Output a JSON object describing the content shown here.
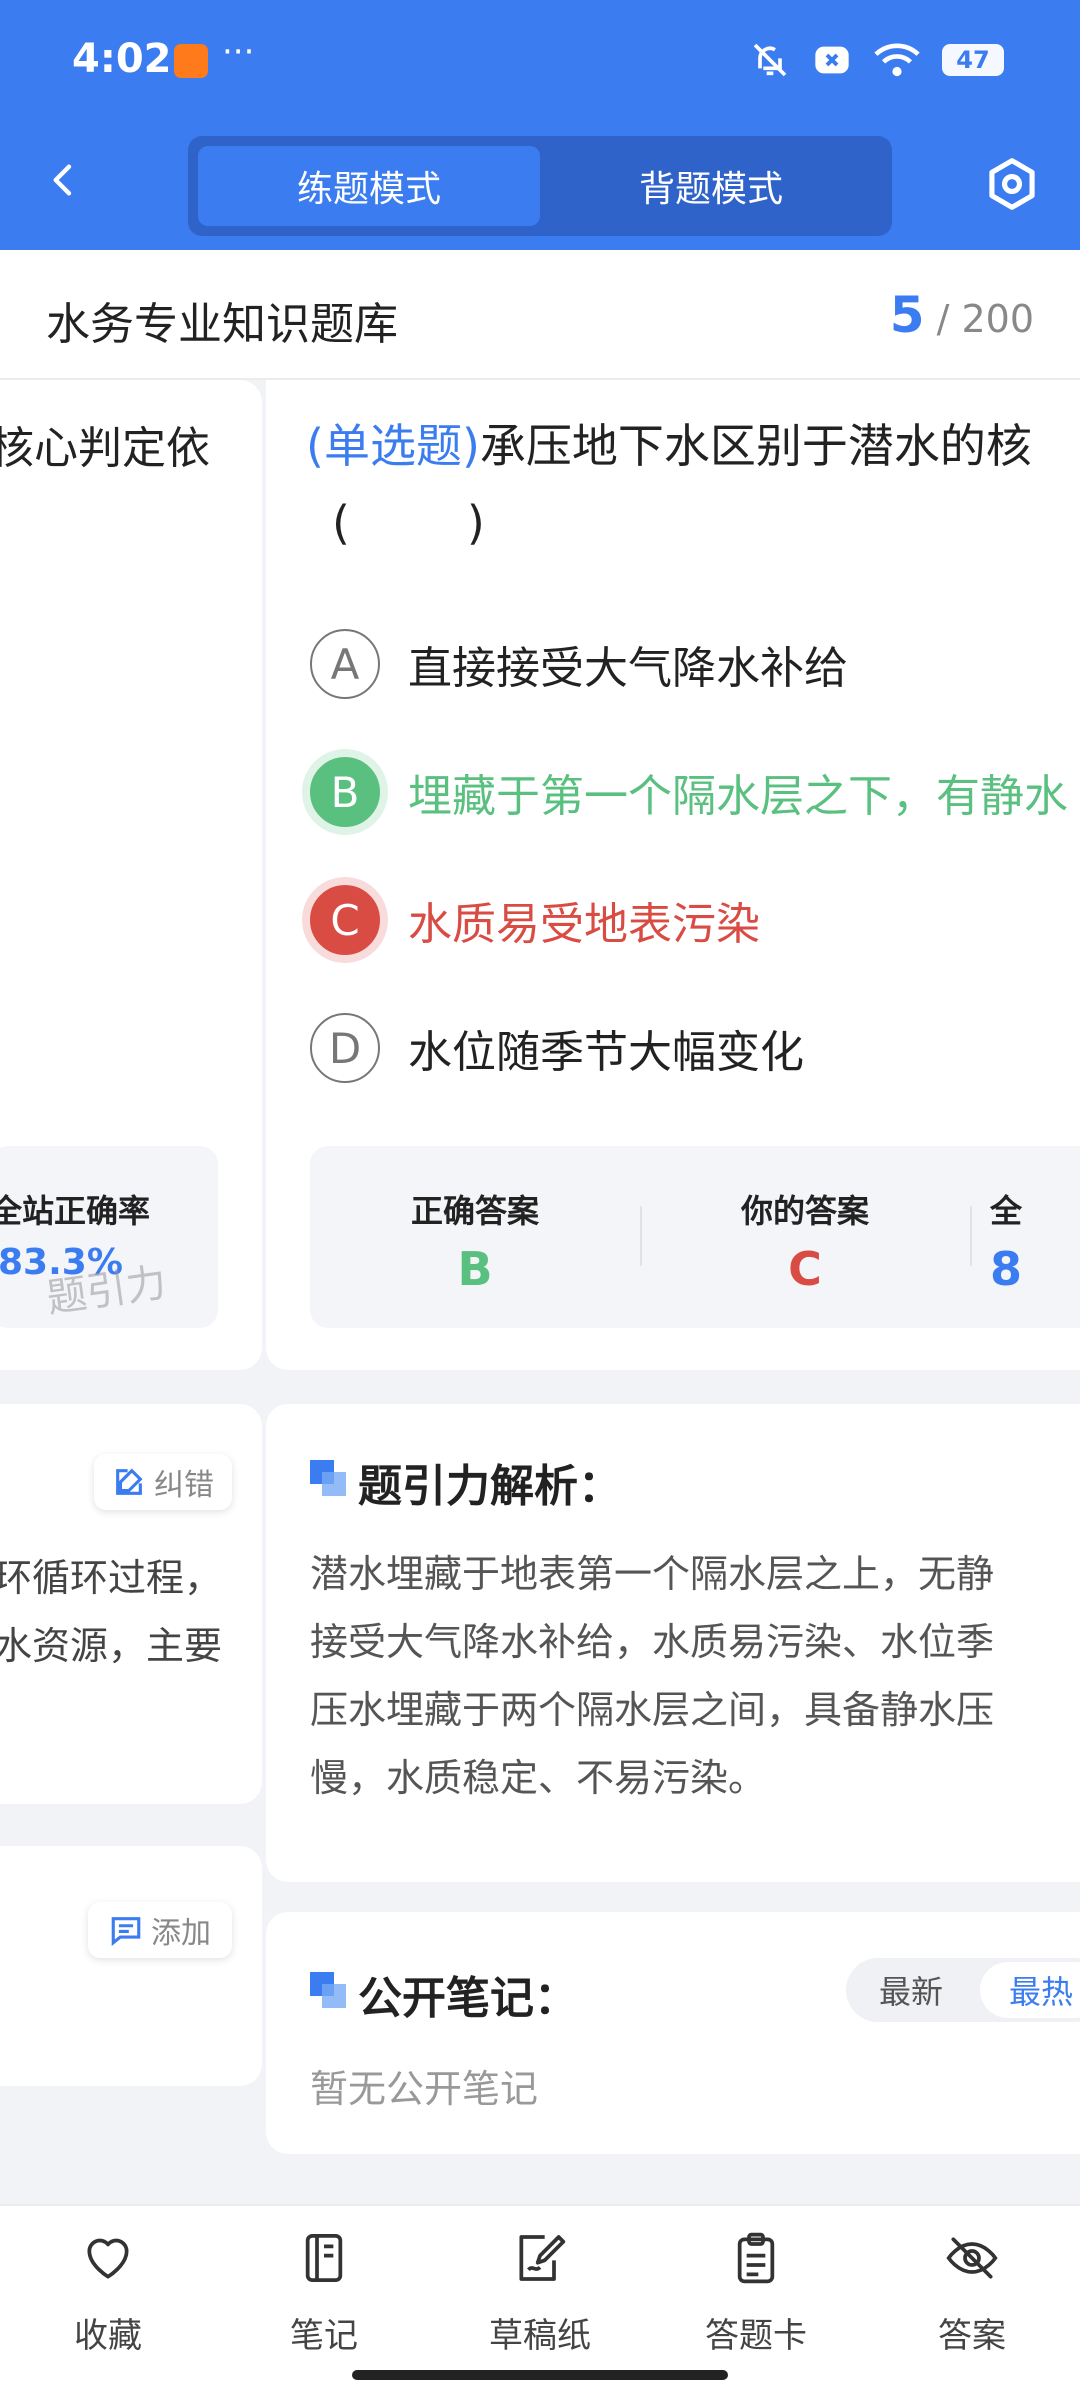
{
  "status_bar": {
    "time": "4:02",
    "more": "···",
    "battery": "47"
  },
  "header": {
    "tabs": [
      {
        "label": "练题模式",
        "active": true
      },
      {
        "label": "背题模式",
        "active": false
      }
    ]
  },
  "title_bar": {
    "bank_title": "水务专业知识题库",
    "current": "5",
    "total": "/ 200"
  },
  "prev_card": {
    "question_fragment": "核心判定依",
    "stat_label": "全站正确率",
    "stat_value": "83.3%",
    "watermark": "题引力",
    "fix_label": "纠错",
    "explanation_lines": [
      "环循环过程，",
      "水资源，主要"
    ],
    "add_label": "添加"
  },
  "question": {
    "type": "(单选题)",
    "text": "承压地下水区别于潜水的核",
    "blank": "(        )",
    "options": [
      {
        "letter": "A",
        "text": "直接接受大气降水补给",
        "state": "normal"
      },
      {
        "letter": "B",
        "text": "埋藏于第一个隔水层之下，有静水",
        "state": "correct"
      },
      {
        "letter": "C",
        "text": "水质易受地表污染",
        "state": "wrong"
      },
      {
        "letter": "D",
        "text": "水位随季节大幅变化",
        "state": "normal"
      }
    ]
  },
  "answer_summary": {
    "correct_label": "正确答案",
    "correct_value": "B",
    "yours_label": "你的答案",
    "yours_value": "C",
    "overall_label": "全",
    "overall_value": "8",
    "colors": {
      "correct": "#5ac07f",
      "wrong": "#d94c43",
      "accent": "#3b7cf0"
    }
  },
  "explanation": {
    "title": "题引力解析：",
    "lines": [
      "潜水埋藏于地表第一个隔水层之上，无静",
      "接受大气降水补给，水质易污染、水位季",
      "压水埋藏于两个隔水层之间，具备静水压",
      "慢，水质稳定、不易污染。"
    ]
  },
  "notes": {
    "title": "公开笔记：",
    "sort_latest": "最新",
    "sort_hot": "最热",
    "empty": "暂无公开笔记"
  },
  "bottom_nav": [
    {
      "label": "收藏",
      "icon": "heart-icon"
    },
    {
      "label": "笔记",
      "icon": "notebook-icon"
    },
    {
      "label": "草稿纸",
      "icon": "draft-paper-icon"
    },
    {
      "label": "答题卡",
      "icon": "answer-card-icon"
    },
    {
      "label": "答案",
      "icon": "eye-off-icon"
    }
  ]
}
